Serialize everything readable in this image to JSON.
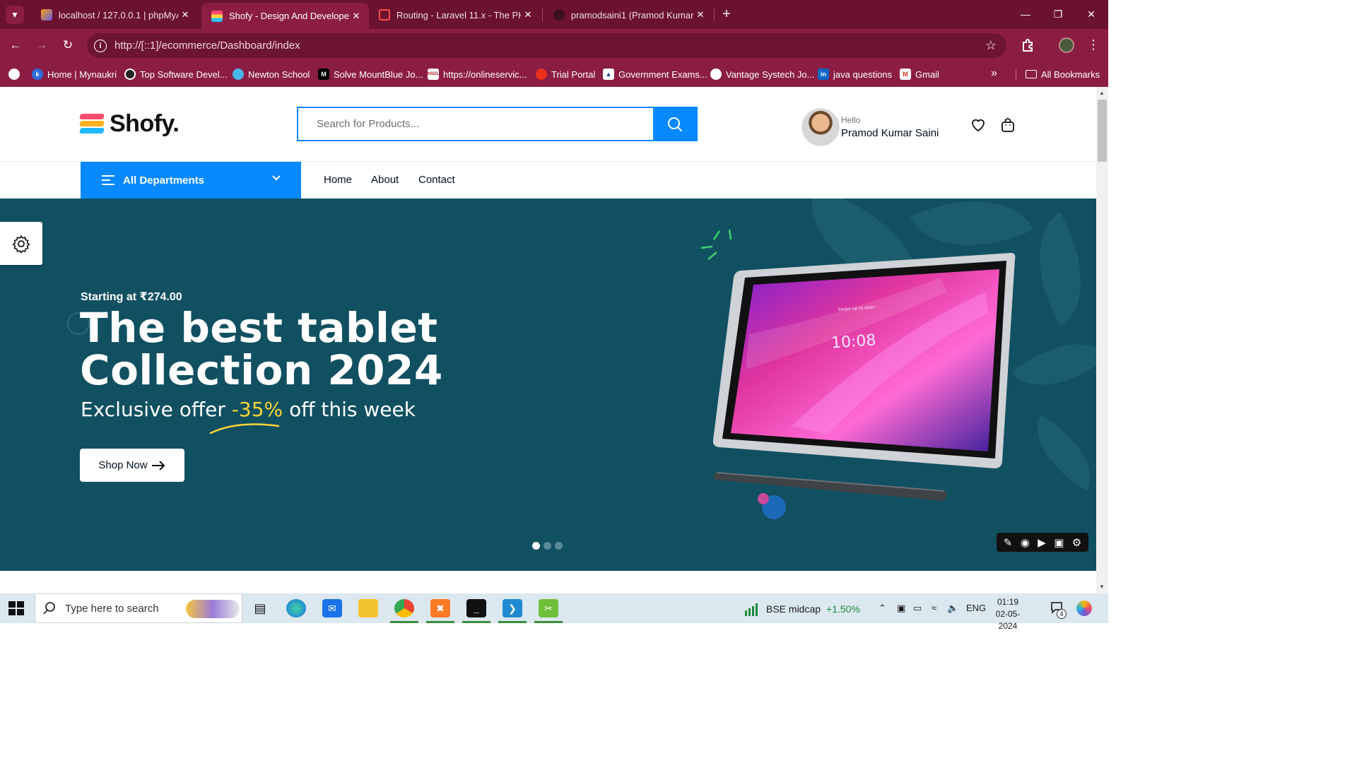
{
  "browser": {
    "tabs": [
      {
        "title": "localhost / 127.0.0.1 | phpMyAdmin",
        "active": false
      },
      {
        "title": "Shofy - Design And Developed",
        "active": true
      },
      {
        "title": "Routing - Laravel 11.x - The PHP",
        "active": false
      },
      {
        "title": "pramodsaini1 (Pramod Kumar Saini)",
        "active": false
      }
    ],
    "url": "http://[::1]/ecommerce/Dashboard/index",
    "bookmarks": [
      "Home | Mynaukri",
      "Top Software Devel...",
      "Newton School",
      "Solve MountBlue Jo...",
      "https://onlineservic...",
      "Trial Portal",
      "Government Exams...",
      "Vantage Systech Jo...",
      "java questions",
      "Gmail"
    ],
    "all_bookmarks_label": "All Bookmarks"
  },
  "site": {
    "logo_text": "Shofy.",
    "search_placeholder": "Search for Products...",
    "user": {
      "greeting": "Hello",
      "name": "Pramod Kumar Saini"
    },
    "departments_label": "All Departments",
    "menu": [
      "Home",
      "About",
      "Contact"
    ]
  },
  "hero": {
    "starting_text": "Starting at ₹274.00",
    "title_line1": "The best tablet",
    "title_line2": "Collection 2024",
    "offer_prefix": "Exclusive offer ",
    "offer_highlight": "-35%",
    "offer_suffix": " off this week",
    "button_label": "Shop Now",
    "tablet_time": "10:08",
    "tablet_lock_text": "Swipe up to open",
    "slides": 3,
    "active_slide": 1
  },
  "taskbar": {
    "search_placeholder": "Type here to search",
    "ticker_name": "BSE midcap",
    "ticker_change": "+1.50%",
    "language": "ENG",
    "time": "01:19",
    "date": "02-05-2024",
    "notification_count": "4"
  },
  "colors": {
    "chrome": "#8b1d45",
    "accent": "#0989ff",
    "hero_bg": "#115061",
    "offer_highlight": "#ffd43a"
  }
}
